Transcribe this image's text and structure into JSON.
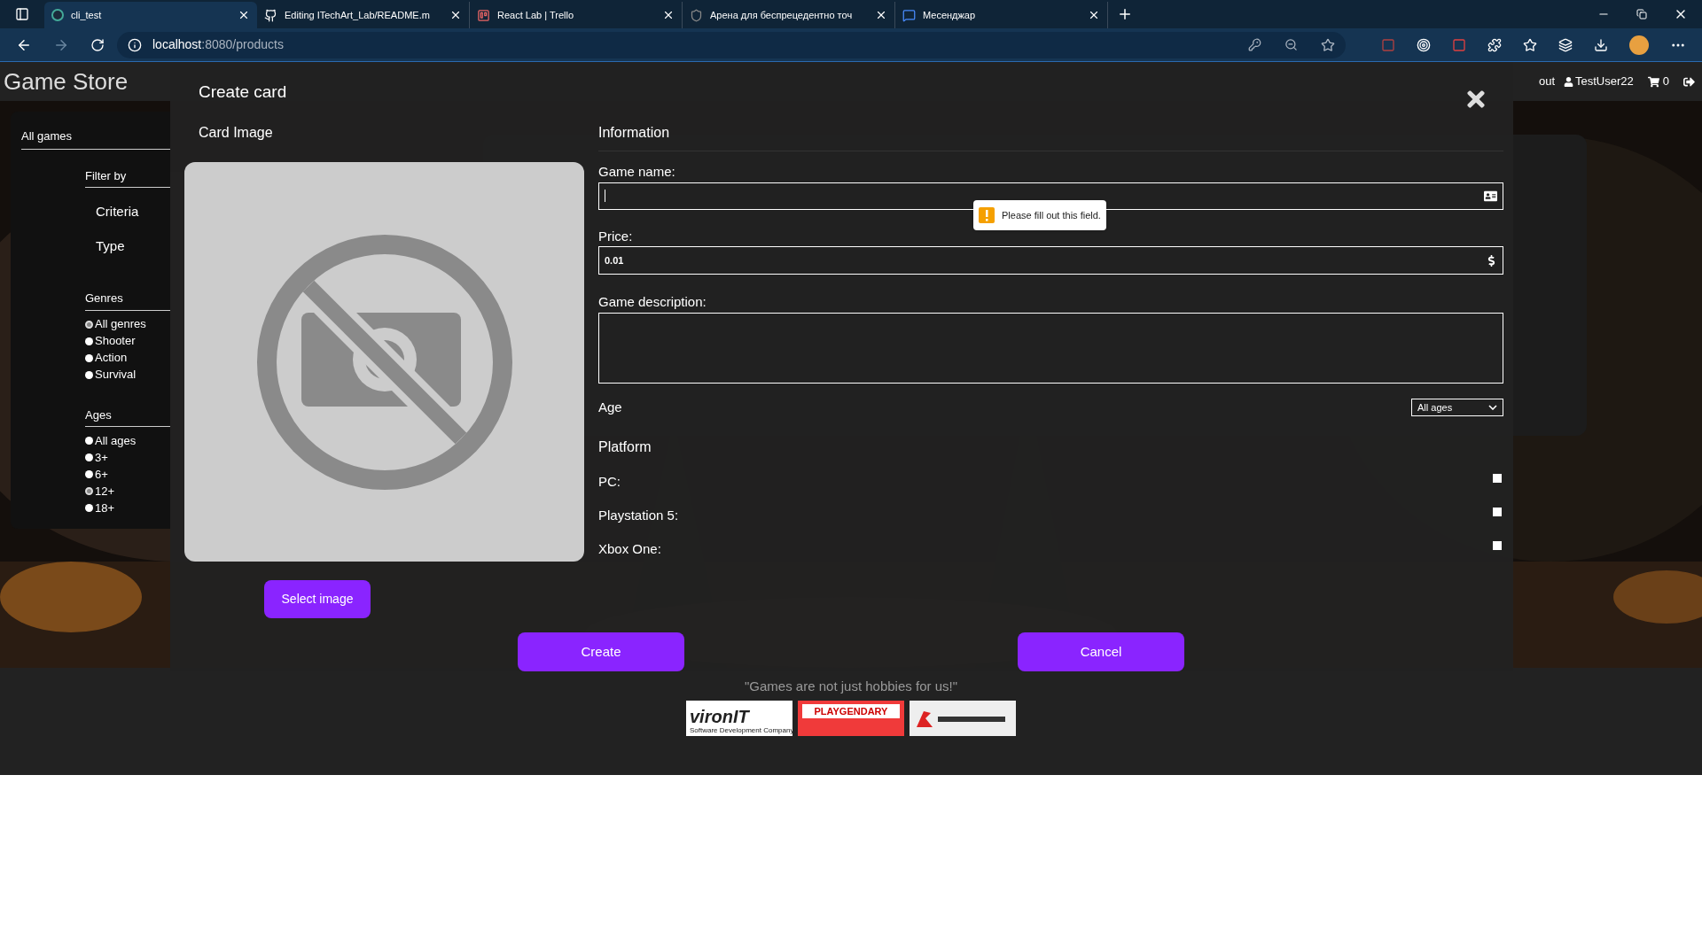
{
  "browser": {
    "tabs": [
      {
        "title": "cli_test",
        "selected": true
      },
      {
        "title": "Editing ITechArt_Lab/README.m",
        "selected": false
      },
      {
        "title": "React Lab | Trello",
        "selected": false
      },
      {
        "title": "Арена для беспрецедентно точ",
        "selected": false
      },
      {
        "title": "Месенджар",
        "selected": false
      }
    ],
    "address": {
      "host": "localhost",
      "path": ":8080/products"
    }
  },
  "header": {
    "logo": "Game Store",
    "nav": [
      "out"
    ],
    "user": "TestUser22",
    "cart_count": "0"
  },
  "sidebar": {
    "title": "All games",
    "filter_title": "Filter by",
    "filters": [
      "Criteria",
      "Type"
    ],
    "genres": {
      "title": "Genres",
      "options": [
        {
          "label": "All genres",
          "selected": true
        },
        {
          "label": "Shooter",
          "selected": false
        },
        {
          "label": "Action",
          "selected": false
        },
        {
          "label": "Survival",
          "selected": false
        }
      ]
    },
    "ages": {
      "title": "Ages",
      "options": [
        {
          "label": "All ages",
          "selected": false
        },
        {
          "label": "3+",
          "selected": false
        },
        {
          "label": "6+",
          "selected": false
        },
        {
          "label": "12+",
          "selected": true
        },
        {
          "label": "18+",
          "selected": false
        }
      ]
    }
  },
  "modal": {
    "title": "Create card",
    "image_title": "Card Image",
    "select_button": "Select image",
    "info_title": "Information",
    "name_label": "Game name:",
    "name_validation": "Please fill out this field.",
    "price_label": "Price:",
    "price_value": "0.01",
    "description_label": "Game description:",
    "age_label": "Age",
    "age_value": "All ages",
    "platform_title": "Platform",
    "platforms": [
      {
        "label": "PC:",
        "checked": false
      },
      {
        "label": "Playstation 5:",
        "checked": false
      },
      {
        "label": "Xbox One:",
        "checked": false
      }
    ],
    "create_button": "Create",
    "cancel_button": "Cancel"
  },
  "footer": {
    "slogan": "\"Games are not just hobbies for us!\"",
    "logos": [
      {
        "kind": "viron",
        "name": "vironIT",
        "tagline": "Software Development Company"
      },
      {
        "kind": "playgendary",
        "name": "PLAYGENDARY"
      },
      {
        "kind": "mark"
      }
    ]
  }
}
